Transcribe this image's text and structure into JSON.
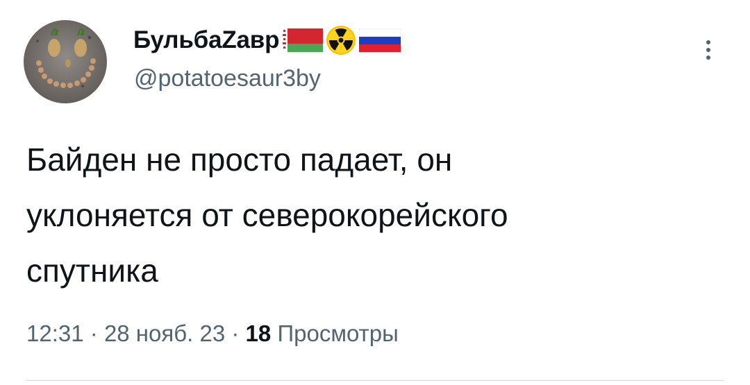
{
  "tweet": {
    "author": {
      "display_name": "БульбаZавр",
      "handle": "@potatoesaur3by",
      "flags": [
        "belarus-flag",
        "radioactive-icon",
        "russia-flag"
      ]
    },
    "text": "Байден не просто падает, он\nуклоняется от северокорейского\nспутника",
    "time": "12:31",
    "separator": "·",
    "date": "28 нояб. 23",
    "views_count": "18",
    "views_label": "Просмотры"
  },
  "colors": {
    "primary_text": "#0f1419",
    "secondary_text": "#536471",
    "divider": "#cfd9de"
  }
}
